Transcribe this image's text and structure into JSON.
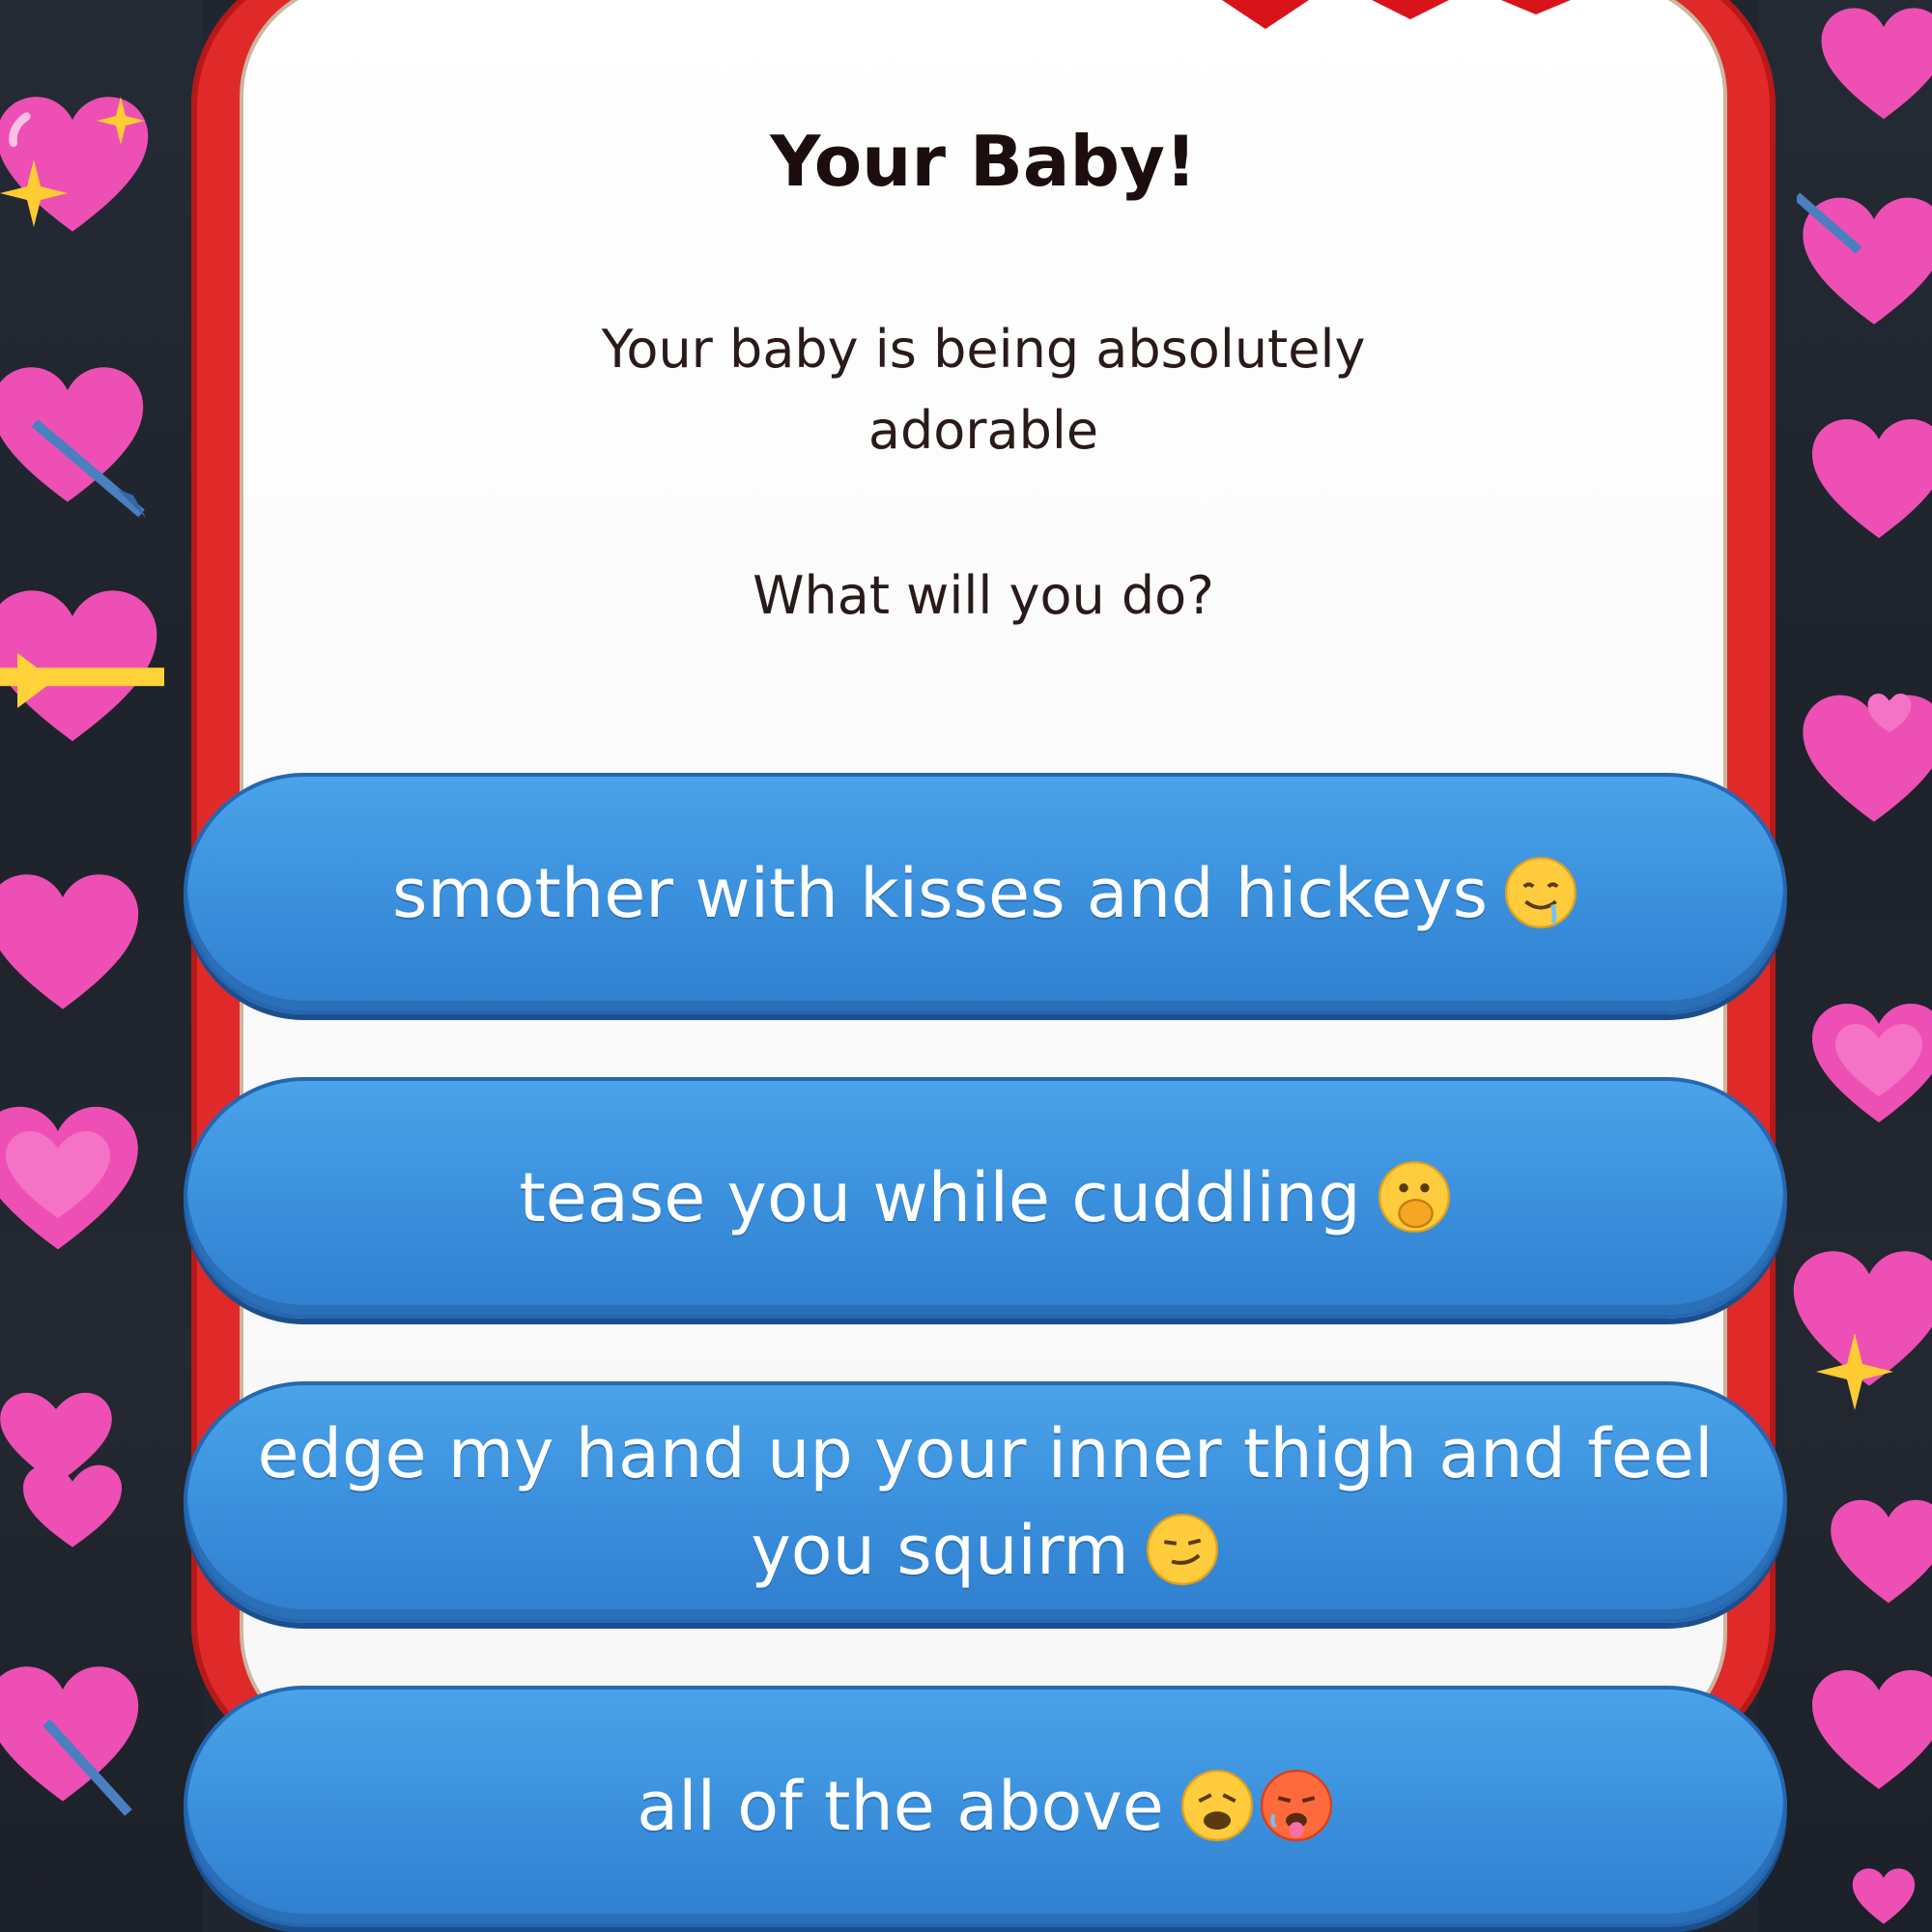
{
  "dialog": {
    "title": "Your Baby!",
    "message": "Your baby is being absolutely adorable",
    "question": "What will you do?"
  },
  "choices": [
    {
      "label": "smother with kisses and hickeys",
      "icon": "drooling-face-icon"
    },
    {
      "label": "tease you while cuddling",
      "icon": "face-with-hand-over-mouth-icon"
    },
    {
      "label": "edge my hand up your inner thigh and feel you squirm",
      "icon": "smirking-face-icon"
    },
    {
      "label": "all of the above",
      "icon": "weary-face-icon hot-face-icon"
    }
  ],
  "colors": {
    "frame_red": "#e02a2a",
    "button_blue": "#3a8fdc",
    "heart_pink": "#ee4fb5",
    "background_dark": "#1f2630"
  }
}
